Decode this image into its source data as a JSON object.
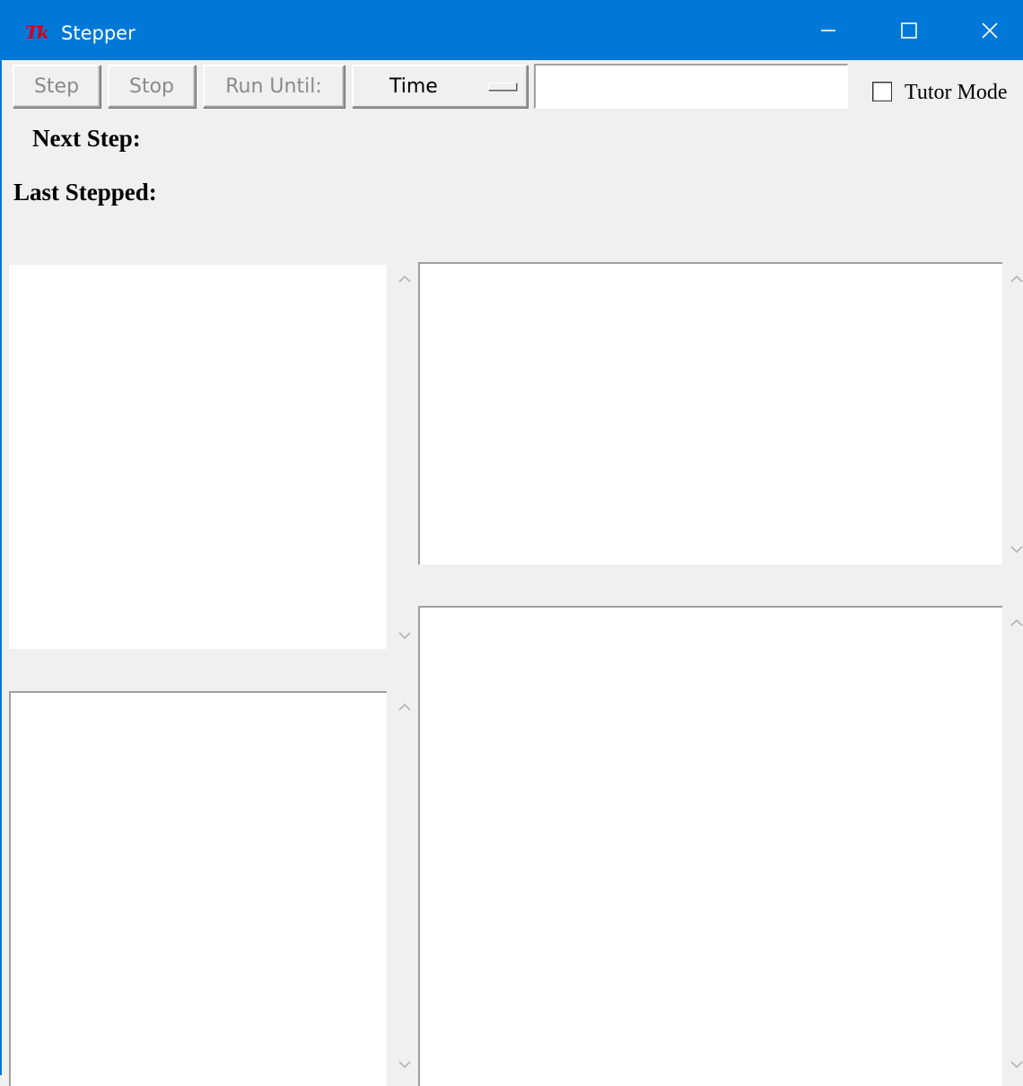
{
  "window": {
    "logo": "Tk",
    "title": "Stepper"
  },
  "toolbar": {
    "step_label": "Step",
    "stop_label": "Stop",
    "run_until_label": "Run Until:",
    "run_until_mode": "Time",
    "run_until_value": "",
    "tutor_mode_label": "Tutor Mode",
    "tutor_mode_checked": false
  },
  "labels": {
    "next_step": "Next Step:",
    "last_stepped": "Last Stepped:"
  },
  "colors": {
    "titlebar": "#0078d7",
    "background": "#f0f0f0",
    "pane": "#ffffff",
    "disabled_text": "#8a8a8a",
    "logo": "#d4001a"
  }
}
